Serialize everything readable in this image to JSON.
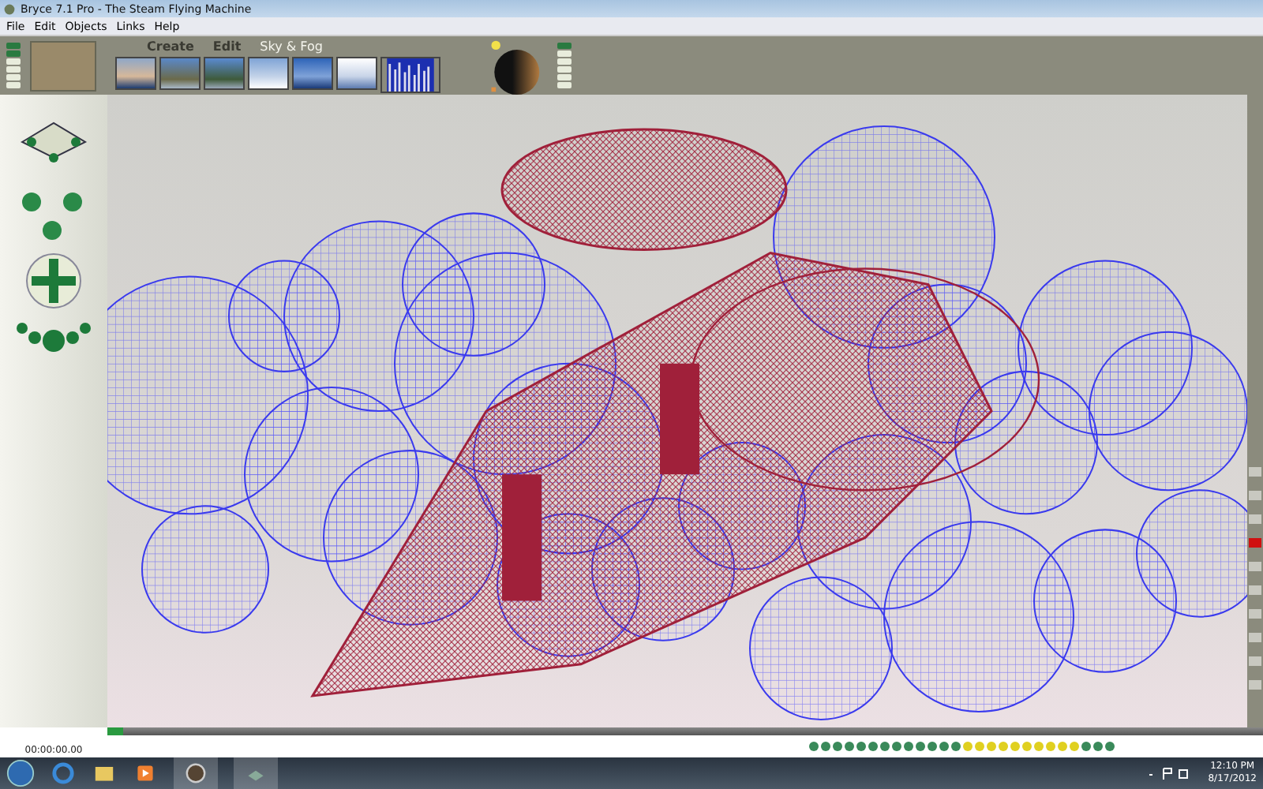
{
  "window": {
    "title": "Bryce 7.1  Pro - The Steam Flying Machine"
  },
  "menu": [
    "File",
    "Edit",
    "Objects",
    "Links",
    "Help"
  ],
  "palette_tabs": [
    {
      "label": "Create",
      "selected": false
    },
    {
      "label": "Edit",
      "selected": false
    },
    {
      "label": "Sky & Fog",
      "selected": true
    }
  ],
  "timeline": {
    "time": "00:00:00.00"
  },
  "taskbar": {
    "time": "12:10 PM",
    "date": "8/17/2012"
  }
}
